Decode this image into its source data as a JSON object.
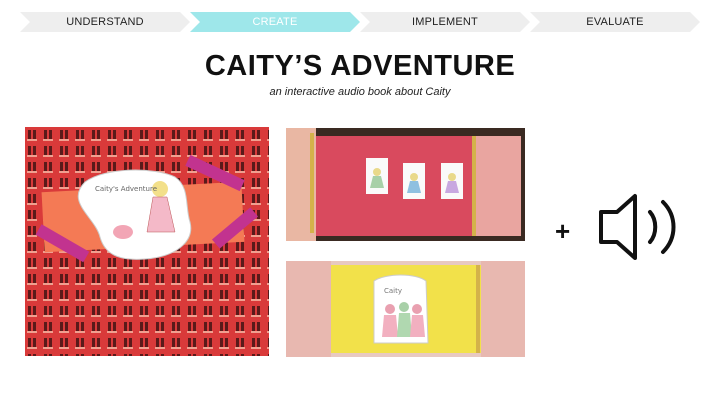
{
  "steps": [
    {
      "label": "UNDERSTAND",
      "state": "inactive"
    },
    {
      "label": "CREATE",
      "state": "active"
    },
    {
      "label": "IMPLEMENT",
      "state": "inactive"
    },
    {
      "label": "EVALUATE",
      "state": "inactive"
    }
  ],
  "colors": {
    "step_inactive": "#eeeeee",
    "step_active": "#9ee7ea",
    "wrap_red": "#d93a3a",
    "page_pink": "#d94a5e",
    "page_yellow": "#f2e14a"
  },
  "title": "CAITY’S ADVENTURE",
  "subtitle": "an interactive audio book about Caity",
  "plus_sign": "+",
  "photos": {
    "cover_label": "Caity's Adventure",
    "inside_label": "Caity"
  },
  "icons": [
    "speaker-icon"
  ]
}
